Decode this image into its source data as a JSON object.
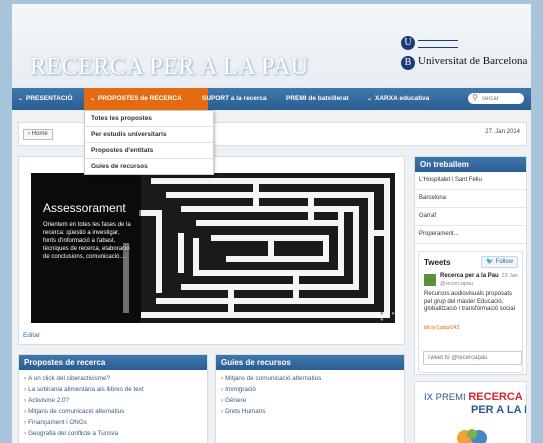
{
  "site_title": "RECERCA PER A LA PAU",
  "university": {
    "name": "Universitat de Barcelona",
    "letters": [
      "U",
      "B"
    ]
  },
  "nav": {
    "items": [
      {
        "label": "PRESENTACIÓ",
        "chevron": true,
        "active": false
      },
      {
        "label": "PROPOSTES de RECERCA",
        "chevron": true,
        "active": true
      },
      {
        "label": "SUPORT a la recerca",
        "chevron": false,
        "active": false
      },
      {
        "label": "PREMI de batxillerat",
        "chevron": false,
        "active": false
      },
      {
        "label": "XARXA educativa",
        "chevron": true,
        "active": false
      }
    ],
    "search_placeholder": "cercar",
    "accent_color": "#e56b12",
    "bar_color": "#2f6aa3"
  },
  "dropdown": [
    "Totes les propostes",
    "Per estudis universitaris",
    "Propostes d'entitats",
    "Guies de recursos"
  ],
  "breadcrumb": {
    "home": "Home",
    "date": "27. Jan 2014"
  },
  "slider": {
    "title": "Assessorament",
    "text": "Orientem en totes les fases de la recerca: qüestió a investigar, fonts d'informació a l'abast, tècniques de recerca, elaboració de conclusions, comunicació....",
    "dots": "● ● ●"
  },
  "edit_link": "Editar",
  "on_treballem": {
    "title": "On treballem",
    "items": [
      "L'Hospitalet i Sant Feliu",
      "Barcelona",
      "Garraf",
      "Properament..."
    ]
  },
  "tweets": {
    "title": "Tweets",
    "follow": "Follow",
    "name": "Recerca per a la Pau",
    "date": "23 Jan",
    "handle": "@recercapau",
    "text": "Recursos audiovisuals proposats pel grup del màster Educació, globalització i transformació social",
    "link": "bit.ly/1atqs043",
    "input_placeholder": "Tweet to @recercapau"
  },
  "propostes": {
    "title": "Propostes de recerca",
    "items": [
      "A un click del ciberactivisme?",
      "La sobirania alimentària als llibres de text",
      "Activisme 2.0?",
      "Mitjans de comunicació alternatius",
      "Finançament i ONGs",
      "Geografia del conflicte a Tunísia"
    ]
  },
  "guies": {
    "title": "Guies de recursos",
    "items": [
      "Mitjans de comunicació alternatius",
      "Immigració",
      "Gènere",
      "Drets Humans"
    ]
  },
  "prize": {
    "line1": "IX PREMI",
    "recerca": "RECERCA",
    "line2": "PER A LA PAU"
  }
}
